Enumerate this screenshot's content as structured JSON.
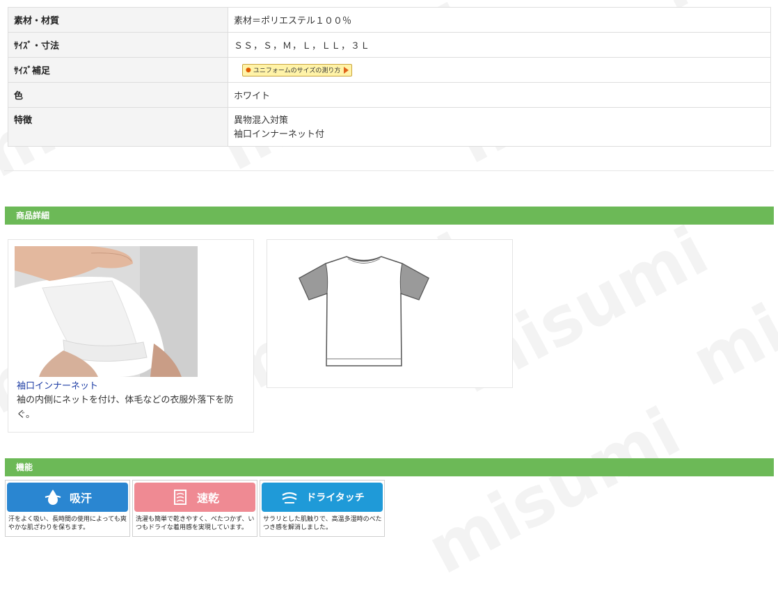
{
  "spec": {
    "rows": [
      {
        "label": "素材・材質",
        "value": "素材＝ポリエステル１００％"
      },
      {
        "label": "ｻｲｽﾞ・寸法",
        "value": "ＳＳ，Ｓ，Ｍ，Ｌ，ＬＬ，３Ｌ"
      },
      {
        "label": "ｻｲｽﾞ補足",
        "button": "ユニフォームのサイズの測り方"
      },
      {
        "label": "色",
        "value": "ホワイト"
      },
      {
        "label": "特徴",
        "lines": [
          "異物混入対策",
          "袖口インナーネット付"
        ]
      }
    ]
  },
  "detail": {
    "header": "商品詳細",
    "caption_title": "袖口インナーネット",
    "caption_text": "袖の内側にネットを付け、体毛などの衣服外落下を防ぐ。"
  },
  "features": {
    "header": "機能",
    "items": [
      {
        "icon": "drop-icon",
        "title": "吸汗",
        "color": "#2a86d1",
        "desc": "汗をよく吸い、長時間の使用によっても爽やかな肌ざわりを保ちます。"
      },
      {
        "icon": "shirt-dry-icon",
        "title": "速乾",
        "color": "#ef8a93",
        "desc": "洗濯も簡単で乾きやすく、べたつかず、いつもドライな着用感を実現しています。"
      },
      {
        "icon": "wind-icon",
        "title": "ドライタッチ",
        "color": "#1f9ad8",
        "desc": "サラリとした肌触りで、高温多湿時のべたつき感を解消しました。"
      }
    ]
  },
  "watermark": "misumi"
}
